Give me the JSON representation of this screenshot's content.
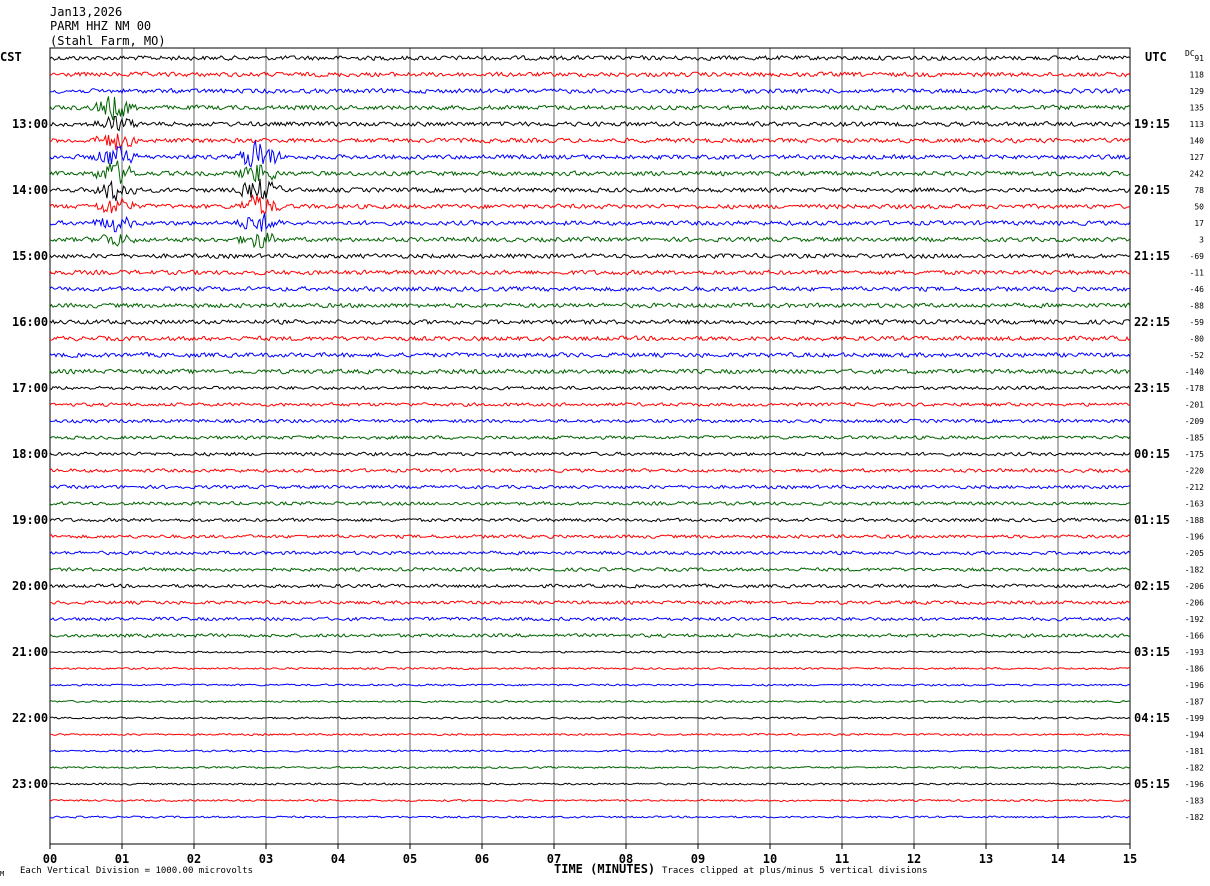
{
  "header": {
    "date": "Jan13,2026",
    "station": "PARM HHZ NM 00",
    "location": "(Stahl Farm, MO)"
  },
  "left_zone": "CST",
  "right_zone": "UTC",
  "dc_header": "DC",
  "footer": {
    "scale_note": "Each Vertical Division = 1000.00 microvolts",
    "clip_note": "Traces clipped at plus/minus 5 vertical divisions",
    "mark": "M"
  },
  "colors": {
    "trace_cycle": [
      "#000000",
      "#ff0000",
      "#0000ff",
      "#006400"
    ],
    "grid": "#000000"
  },
  "chart_data": {
    "type": "line",
    "title": "",
    "xlabel": "TIME (MINUTES)",
    "ylabel": "",
    "xlim": [
      0,
      15
    ],
    "x_ticks": [
      "00",
      "01",
      "02",
      "03",
      "04",
      "05",
      "06",
      "07",
      "08",
      "09",
      "10",
      "11",
      "12",
      "13",
      "14",
      "15"
    ],
    "row_interval_minutes": 15,
    "left_time_labels": [
      "13:00",
      "14:00",
      "15:00",
      "16:00",
      "17:00",
      "18:00",
      "19:00",
      "20:00",
      "21:00",
      "22:00",
      "23:00"
    ],
    "right_time_labels": [
      "19:15",
      "20:15",
      "21:15",
      "22:15",
      "23:15",
      "00:15",
      "01:15",
      "02:15",
      "03:15",
      "04:15",
      "05:15"
    ],
    "dc_offsets": [
      91,
      118,
      129,
      135,
      113,
      140,
      127,
      242,
      78,
      50,
      17,
      3,
      -69,
      -11,
      -46,
      -88,
      -59,
      -80,
      -52,
      -140,
      -178,
      -201,
      -209,
      -185,
      -175,
      -220,
      -212,
      -163,
      -188,
      -196,
      -205,
      -182,
      -206,
      -206,
      -192,
      -166,
      -193,
      -186,
      -196,
      -187,
      -199,
      -194,
      -181,
      -182,
      -196,
      -183,
      -182
    ],
    "events": [
      {
        "rows": [
          3,
          11
        ],
        "minute": 0.9
      },
      {
        "rows": [
          6,
          11
        ],
        "minute": 2.9
      }
    ]
  }
}
